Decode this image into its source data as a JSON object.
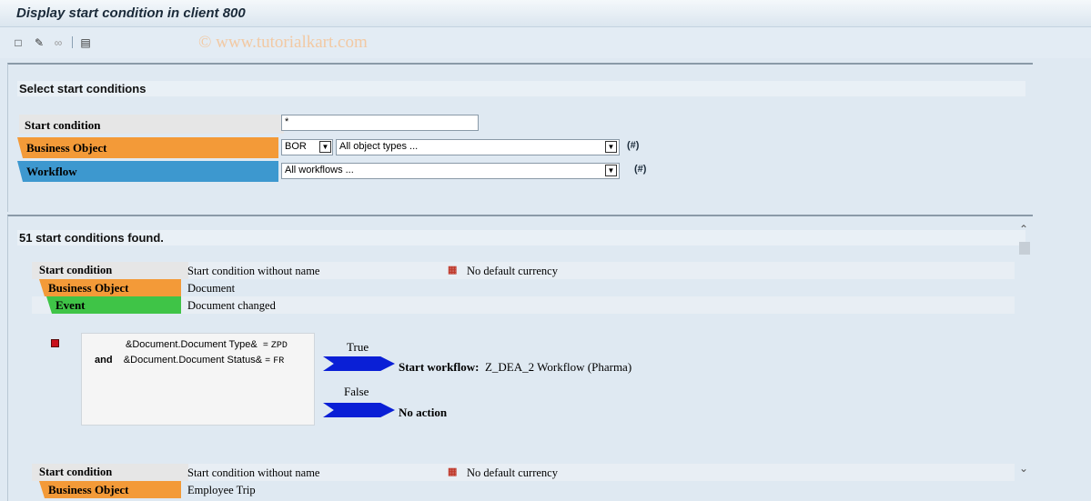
{
  "window": {
    "title": "Display start condition in client 800"
  },
  "toolbar": {
    "icons": [
      "new-icon",
      "edit-pencil-icon",
      "glasses-icon",
      "transport-icon"
    ],
    "watermark": "© www.tutorialkart.com"
  },
  "selection": {
    "heading": "Select start conditions",
    "start_condition_label": "Start condition",
    "start_condition_value": "*",
    "business_object_label": "Business Object",
    "bo_type_value": "BOR",
    "bo_object_value": "All object types ...",
    "workflow_label": "Workflow",
    "workflow_value": "All workflows ..."
  },
  "results": {
    "heading": "51 start conditions found.",
    "items": [
      {
        "start_condition_label": "Start condition",
        "start_condition_value": "Start condition without name",
        "currency_note": "No default currency",
        "business_object_label": "Business Object",
        "business_object_value": "Document",
        "event_label": "Event",
        "event_value": "Document changed",
        "conditions": [
          {
            "lhs": "&Document.Document Type&",
            "op": "=",
            "rhs": "ZPD"
          },
          {
            "connector": "and",
            "lhs": "&Document.Document Status&",
            "op": "=",
            "rhs": "FR"
          }
        ],
        "true_label": "True",
        "start_workflow_label": "Start workflow:",
        "start_workflow_value": "Z_DEA_2 Workflow (Pharma)",
        "false_label": "False",
        "no_action_label": "No action"
      },
      {
        "start_condition_label": "Start condition",
        "start_condition_value": "Start condition without name",
        "currency_note": "No default currency",
        "business_object_label": "Business Object",
        "business_object_value": "Employee Trip"
      }
    ]
  },
  "colors": {
    "business_object_tag": "#f39a38",
    "workflow_tag": "#3d98cf",
    "event_tag": "#3fc447",
    "arrow": "#0a1fd6"
  }
}
